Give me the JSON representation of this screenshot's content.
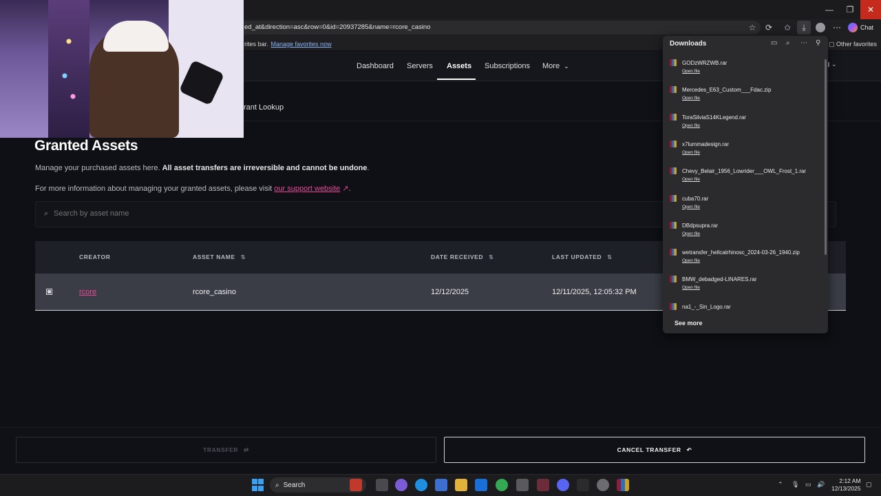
{
  "browser": {
    "url": "ed_at&direction=asc&row=0&id=20937285&name=rcore_casino",
    "favorites_hint": "rites bar.",
    "favorites_link": "Manage favorites now",
    "other_favorites": "Other favorites",
    "chat_label": "Chat"
  },
  "nav": {
    "items": [
      "Dashboard",
      "Servers",
      "Assets",
      "Subscriptions",
      "More"
    ],
    "active": "Assets",
    "sub_item": "rant Lookup"
  },
  "page": {
    "title": "Granted Assets",
    "desc_plain": "Manage your purchased assets here. ",
    "desc_bold": "All asset transfers are irreversible and cannot be undone",
    "desc_end": ".",
    "info_prefix": "For more information about managing your granted assets, please visit ",
    "info_link": "our support website",
    "info_suffix": ".",
    "search_placeholder": "Search by asset name"
  },
  "table": {
    "headers": [
      "CREATOR",
      "ASSET NAME",
      "DATE RECEIVED",
      "LAST UPDATED"
    ],
    "rows": [
      {
        "creator": "rcore",
        "asset_name": "rcore_casino",
        "date_received": "12/12/2025",
        "last_updated": "12/11/2025, 12:05:32 PM"
      }
    ]
  },
  "actions": {
    "transfer": "TRANSFER",
    "cancel_transfer": "CANCEL TRANSFER"
  },
  "downloads": {
    "title": "Downloads",
    "open_file": "Open file",
    "items": [
      "GODzWRZWB.rar",
      "Mercedes_E63_Custom___Fdac.zip",
      "ToraSilviaS14KLegend.rar",
      "x7lummadesign.rar",
      "Chevy_Belair_1956_Lowrider___OWL_Frost_1.rar",
      "cuba70.rar",
      "DBdpsupra.rar",
      "wetransfer_hellcatrhinosc_2024-03-26_1940.zip",
      "BMW_debadged-LINARES.rar",
      "na1_-_Sin_Logo.rar"
    ],
    "see_more": "See more"
  },
  "taskbar": {
    "search_label": "Search",
    "time": "2:12 AM",
    "date": "12/13/2025"
  },
  "colors": {
    "accent_pink": "#ec4899",
    "background": "#0e1015",
    "close_red": "#c42b1c"
  }
}
